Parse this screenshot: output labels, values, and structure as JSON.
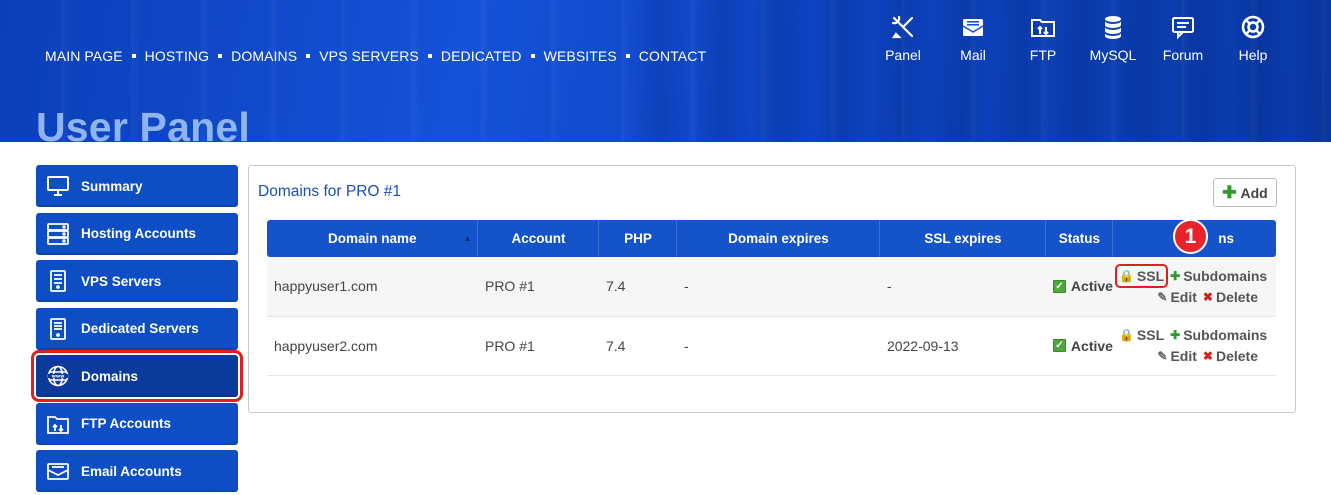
{
  "nav": [
    "MAIN PAGE",
    "HOSTING",
    "DOMAINS",
    "VPS SERVERS",
    "DEDICATED",
    "WEBSITES",
    "CONTACT"
  ],
  "tools": [
    {
      "label": "Panel",
      "icon": "tools-icon"
    },
    {
      "label": "Mail",
      "icon": "mail-icon"
    },
    {
      "label": "FTP",
      "icon": "ftp-folder-icon"
    },
    {
      "label": "MySQL",
      "icon": "database-icon"
    },
    {
      "label": "Forum",
      "icon": "forum-icon"
    },
    {
      "label": "Help",
      "icon": "lifebuoy-icon"
    }
  ],
  "panel_title": "User Panel",
  "sidebar": [
    {
      "label": "Summary",
      "icon": "monitor-icon"
    },
    {
      "label": "Hosting Accounts",
      "icon": "server-icon"
    },
    {
      "label": "VPS Servers",
      "icon": "vps-icon"
    },
    {
      "label": "Dedicated Servers",
      "icon": "dedicated-icon"
    },
    {
      "label": "Domains",
      "icon": "www-globe-icon",
      "active": true
    },
    {
      "label": "FTP Accounts",
      "icon": "ftp-folder-icon"
    },
    {
      "label": "Email Accounts",
      "icon": "email-icon"
    }
  ],
  "content": {
    "title": "Domains for PRO #1",
    "add_label": "Add"
  },
  "table": {
    "headers": [
      "Domain name",
      "Account",
      "PHP",
      "Domain expires",
      "SSL expires",
      "Status",
      "ns"
    ],
    "rows": [
      {
        "domain": "happyuser1.com",
        "account": "PRO #1",
        "php": "7.4",
        "domain_expires": "-",
        "ssl_expires": "-",
        "status": "Active"
      },
      {
        "domain": "happyuser2.com",
        "account": "PRO #1",
        "php": "7.4",
        "domain_expires": "-",
        "ssl_expires": "2022-09-13",
        "status": "Active"
      }
    ],
    "actions": {
      "ssl": "SSL",
      "subdomains": "Subdomains",
      "edit": "Edit",
      "delete": "Delete"
    }
  },
  "badge": "1",
  "colors": {
    "header_blue": "#1552d8",
    "sidebar_blue": "#0d4ec4",
    "highlight_red": "#e02020",
    "active_green": "#4fa83a"
  }
}
